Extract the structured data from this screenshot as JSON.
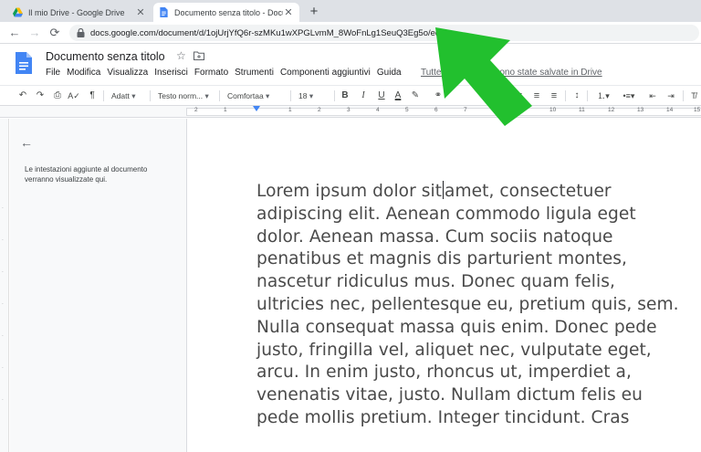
{
  "browser": {
    "tabs": [
      {
        "title": "Il mio Drive - Google Drive",
        "active": false,
        "icon": "google-drive-icon"
      },
      {
        "title": "Documento senza titolo - Docum",
        "active": true,
        "icon": "google-docs-icon"
      }
    ],
    "new_tab_label": "+",
    "url": "docs.google.com/document/d/1ojUrjYfQ6r-szMKu1wXPGLvmM_8WoFnLg1SeuQ3Eg5o/edit"
  },
  "docs": {
    "title": "Documento senza titolo",
    "menu": [
      "File",
      "Modifica",
      "Visualizza",
      "Inserisci",
      "Formato",
      "Strumenti",
      "Componenti aggiuntivi",
      "Guida"
    ],
    "save_status": "Tutte le modifiche sono state salvate in Drive"
  },
  "toolbar": {
    "zoom": "Adatt",
    "style": "Testo norm...",
    "font": "Comfortaa",
    "size": "18",
    "bold": "B",
    "italic": "I",
    "underline": "U",
    "text_color": "A"
  },
  "ruler": {
    "numbers": [
      "2",
      "1",
      "1",
      "2",
      "3",
      "4",
      "5",
      "6",
      "7",
      "8",
      "9",
      "10",
      "11",
      "12",
      "13",
      "14",
      "15"
    ]
  },
  "outline": {
    "placeholder": "Le intestazioni aggiunte al documento verranno visualizzate qui."
  },
  "document": {
    "line_1_before_caret": "Lorem ipsum dolor sit",
    "line_1_after_caret": "amet, consectetuer",
    "lines": [
      "adipiscing elit. Aenean commodo ligula eget",
      "dolor. Aenean massa. Cum sociis natoque",
      "penatibus et magnis dis parturient montes,",
      "nascetur ridiculus mus. Donec quam felis,",
      "ultricies nec, pellentesque eu, pretium quis, sem.",
      "Nulla consequat massa quis enim. Donec pede",
      "justo, fringilla vel, aliquet nec, vulputate eget,",
      "arcu. In enim justo, rhoncus ut, imperdiet a,",
      "venenatis vitae, justo. Nullam dictum felis eu",
      "pede mollis pretium. Integer tincidunt. Cras"
    ]
  },
  "colors": {
    "annotation_arrow": "#22c02e",
    "docs_blue": "#4285f4",
    "selection": "#d3e3fd"
  }
}
